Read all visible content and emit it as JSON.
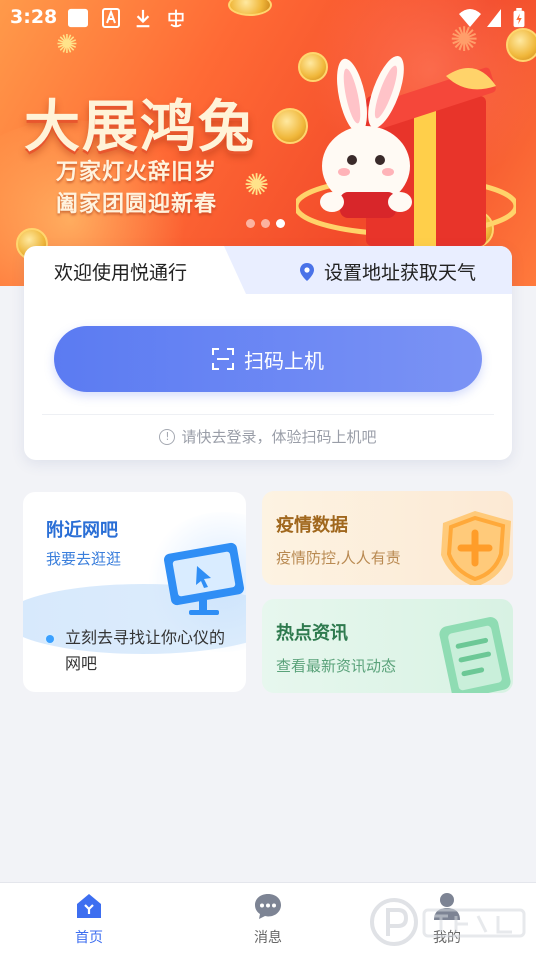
{
  "status_bar": {
    "time": "3:28"
  },
  "banner": {
    "title": "大展鸿兔",
    "line1": "万家灯火辞旧岁",
    "line2": "阖家团圆迎新春",
    "carousel_active_index": 2,
    "carousel_count": 3
  },
  "main_card": {
    "welcome": "欢迎使用悦通行",
    "weather_label": "设置地址获取天气",
    "scan_button": "扫码上机",
    "hint": "请快去登录，体验扫码上机吧",
    "hint_icon": "info-icon"
  },
  "features": {
    "nearby": {
      "title": "附近网吧",
      "subtitle": "我要去逛逛",
      "description": "立刻去寻找让你心仪的网吧",
      "icon": "monitor-cursor-icon"
    },
    "epidemic": {
      "title": "疫情数据",
      "subtitle": "疫情防控,人人有责",
      "icon": "shield-plus-icon"
    },
    "news": {
      "title": "热点资讯",
      "subtitle": "查看最新资讯动态",
      "icon": "document-icon"
    }
  },
  "bottom_nav": {
    "items": [
      {
        "label": "首页",
        "icon": "home-icon",
        "active": true
      },
      {
        "label": "消息",
        "icon": "chat-bubble-icon",
        "active": false
      },
      {
        "label": "我的",
        "icon": "user-icon",
        "active": false
      }
    ]
  },
  "colors": {
    "accent": "#3d6ef0",
    "scan_gradient_start": "#5b7bf2",
    "scan_gradient_end": "#7b93f5",
    "banner_orange": "#ff6a35"
  }
}
